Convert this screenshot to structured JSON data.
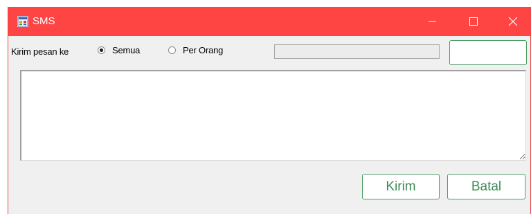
{
  "window": {
    "title": "SMS",
    "icon": "app-window-icon",
    "accent_color": "#ff4444",
    "controls": {
      "minimize_icon": "minimize-icon",
      "maximize_icon": "maximize-icon",
      "close_icon": "close-icon"
    }
  },
  "form": {
    "recipient_label": "Kirim pesan ke",
    "radio_options": [
      {
        "label": "Semua",
        "checked": true
      },
      {
        "label": "Per Orang",
        "checked": false
      }
    ],
    "recipient_field_value": "",
    "lookup_button_label": "",
    "message_value": ""
  },
  "actions": {
    "send_label": "Kirim",
    "cancel_label": "Batal",
    "button_text_color": "#3c8c55"
  }
}
